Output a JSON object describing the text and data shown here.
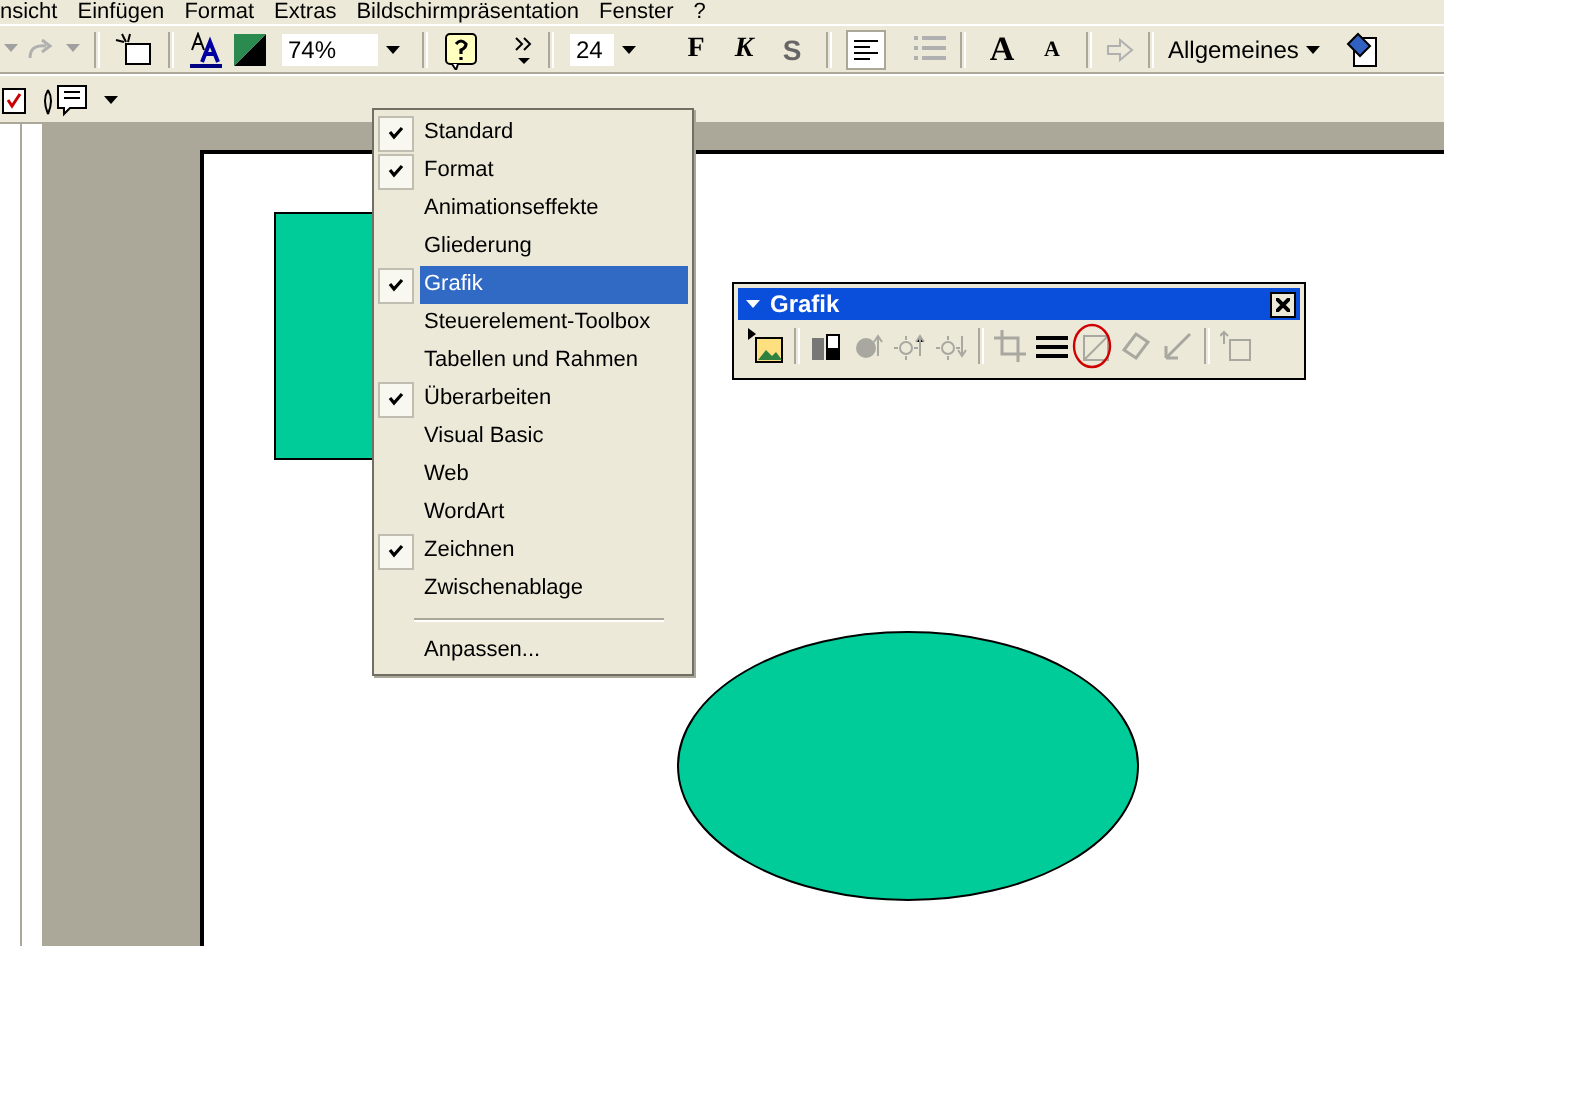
{
  "menubar": [
    {
      "label": "nsicht"
    },
    {
      "label": "Einfügen"
    },
    {
      "label": "Format"
    },
    {
      "label": "Extras"
    },
    {
      "label": "Bildschirmpräsentation"
    },
    {
      "label": "Fenster"
    },
    {
      "label": "?"
    }
  ],
  "toolbar": {
    "zoom": "74%",
    "font_size": "24",
    "bold": "F",
    "italic": "K",
    "shadow": "S",
    "grow_font": "A",
    "shrink_font": "A",
    "align_left_pressed": true,
    "design": "Allgemeines"
  },
  "context_menu": {
    "items": [
      {
        "label": "Standard",
        "checked": true,
        "selected": false
      },
      {
        "label": "Format",
        "checked": true,
        "selected": false
      },
      {
        "label": "Animationseffekte",
        "checked": false,
        "selected": false
      },
      {
        "label": "Gliederung",
        "checked": false,
        "selected": false
      },
      {
        "label": "Grafik",
        "checked": true,
        "selected": true
      },
      {
        "label": "Steuerelement-Toolbox",
        "checked": false,
        "selected": false
      },
      {
        "label": "Tabellen und Rahmen",
        "checked": false,
        "selected": false
      },
      {
        "label": "Überarbeiten",
        "checked": true,
        "selected": false
      },
      {
        "label": "Visual Basic",
        "checked": false,
        "selected": false
      },
      {
        "label": "Web",
        "checked": false,
        "selected": false
      },
      {
        "label": "WordArt",
        "checked": false,
        "selected": false
      },
      {
        "label": "Zeichnen",
        "checked": true,
        "selected": false
      },
      {
        "label": "Zwischenablage",
        "checked": false,
        "selected": false
      }
    ],
    "footer": "Anpassen..."
  },
  "picture_toolbar": {
    "title": "Grafik"
  }
}
